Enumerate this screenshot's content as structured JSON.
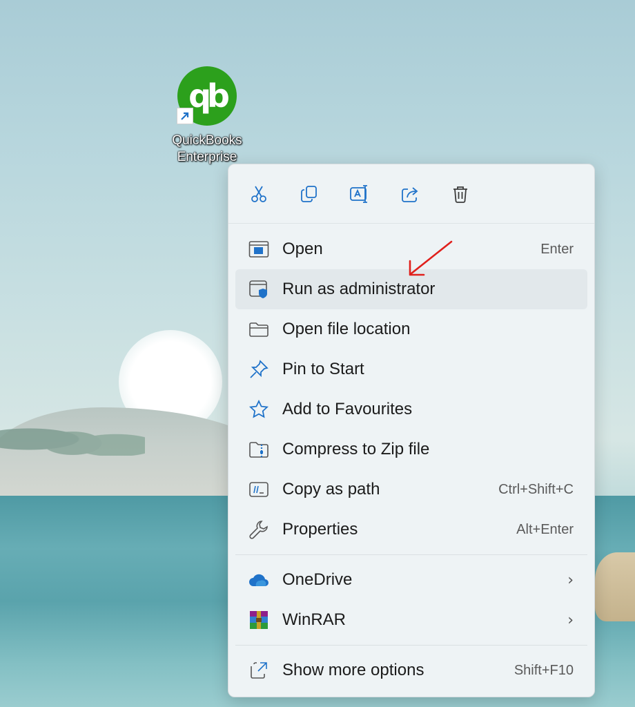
{
  "desktop": {
    "icon_label_line1": "QuickBooks",
    "icon_label_line2": "Enterprise",
    "logo_text": "qb"
  },
  "menu": {
    "toolbar": [
      {
        "name": "cut-icon",
        "tooltip": "Cut"
      },
      {
        "name": "copy-icon",
        "tooltip": "Copy"
      },
      {
        "name": "rename-icon",
        "tooltip": "Rename"
      },
      {
        "name": "share-icon",
        "tooltip": "Share"
      },
      {
        "name": "delete-icon",
        "tooltip": "Delete"
      }
    ],
    "items": [
      {
        "label": "Open",
        "shortcut": "Enter",
        "icon": "open-window-icon"
      },
      {
        "label": "Run as administrator",
        "shortcut": "",
        "icon": "shield-window-icon"
      },
      {
        "label": "Open file location",
        "shortcut": "",
        "icon": "folder-icon"
      },
      {
        "label": "Pin to Start",
        "shortcut": "",
        "icon": "pin-icon"
      },
      {
        "label": "Add to Favourites",
        "shortcut": "",
        "icon": "star-icon"
      },
      {
        "label": "Compress to Zip file",
        "shortcut": "",
        "icon": "zip-folder-icon"
      },
      {
        "label": "Copy as path",
        "shortcut": "Ctrl+Shift+C",
        "icon": "copy-path-icon"
      },
      {
        "label": "Properties",
        "shortcut": "Alt+Enter",
        "icon": "wrench-icon"
      }
    ],
    "submenus": [
      {
        "label": "OneDrive",
        "chevron": "›",
        "icon": "onedrive-cloud-icon"
      },
      {
        "label": "WinRAR",
        "chevron": "›",
        "icon": "winrar-icon"
      }
    ],
    "more": {
      "label": "Show more options",
      "shortcut": "Shift+F10",
      "icon": "show-more-icon"
    }
  },
  "colors": {
    "accent_blue": "#1f72c9",
    "annotation_red": "#e0201c",
    "qb_green": "#2ca01c"
  }
}
